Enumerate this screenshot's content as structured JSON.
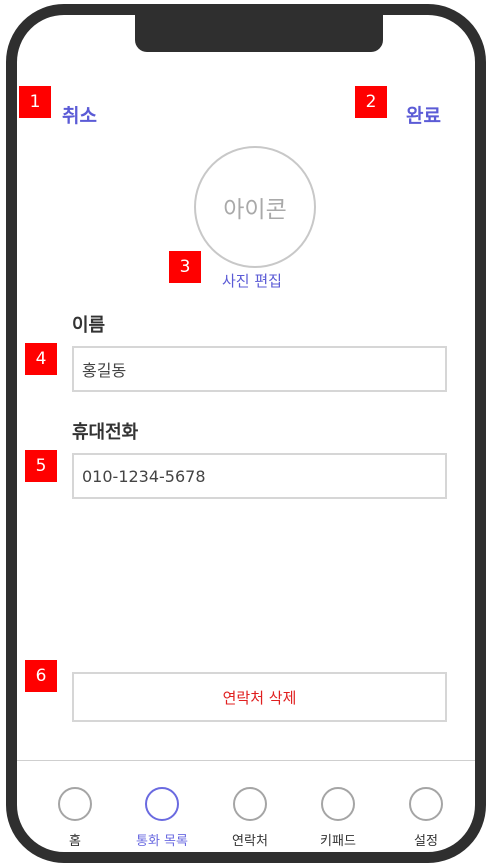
{
  "header": {
    "cancel_label": "취소",
    "done_label": "완료"
  },
  "profile": {
    "icon_text": "아이콘",
    "edit_photo_label": "사진 편집"
  },
  "form": {
    "name_label": "이름",
    "name_value": "홍길동",
    "phone_label": "휴대전화",
    "phone_value": "010-1234-5678"
  },
  "delete_label": "연락처 삭제",
  "markers": [
    "1",
    "2",
    "3",
    "4",
    "5",
    "6"
  ],
  "tabbar": {
    "items": [
      {
        "label": "홈"
      },
      {
        "label": "통화 목록"
      },
      {
        "label": "연락처"
      },
      {
        "label": "키패드"
      },
      {
        "label": "설정"
      }
    ]
  },
  "colors": {
    "accent": "#5b5bd6",
    "danger": "#e02020",
    "marker": "#ff0000",
    "frame": "#2f2f2f"
  }
}
